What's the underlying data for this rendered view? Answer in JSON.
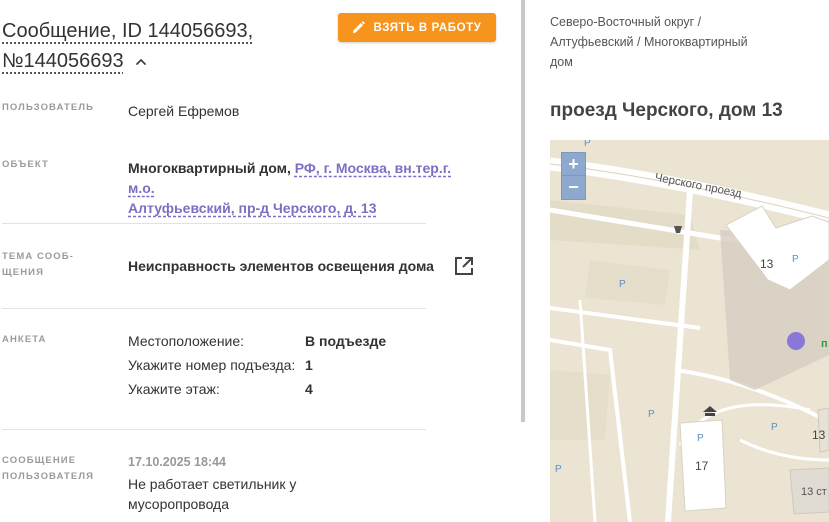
{
  "header": {
    "title_line1": "Сообщение, ID 144056693,",
    "title_line2": "№144056693",
    "take_button": "ВЗЯТЬ В РАБОТУ"
  },
  "user": {
    "label": "ПОЛЬЗОВАТЕЛЬ",
    "value": "Сергей Ефремов"
  },
  "object": {
    "label": "ОБЪЕКТ",
    "type": "Многоквартирный дом,",
    "address_line1": "РФ, г. Москва, вн.тер.г. м.о.",
    "address_line2": "Алтуфьевский, пр-д Черского, д. 13"
  },
  "topic": {
    "label_line1": "ТЕМА СООБ-",
    "label_line2": "ЩЕНИЯ",
    "value": "Неисправность элементов освещения дома"
  },
  "survey": {
    "label": "АНКЕТА",
    "rows": [
      {
        "key": "Местоположение:",
        "value": "В подъезде"
      },
      {
        "key": "Укажите номер подъезда:",
        "value": "1"
      },
      {
        "key": "Укажите этаж:",
        "value": "4"
      }
    ]
  },
  "user_message": {
    "label_line1": "СООБЩЕНИЕ",
    "label_line2": "ПОЛЬЗОВАТЕЛЯ",
    "date": "17.10.2025 18:44",
    "text": "Не работает светильник у мусоропровода"
  },
  "location": {
    "breadcrumb_line1": "Северо-Восточный округ /",
    "breadcrumb_line2": "Алтуфьевский / Многоквартирный",
    "breadcrumb_line3": "дом",
    "address": "проезд Черского, дом 13"
  },
  "map": {
    "street_label": "Черского проезд",
    "zoom_in": "+",
    "zoom_out": "−",
    "building_13": "13",
    "building_17": "17",
    "building_13_right": "13",
    "building_13_corner": "13 ст",
    "parking": "P",
    "green_label": "п"
  },
  "colors": {
    "accent": "#f7941d",
    "link": "#7b6fc4",
    "marker": "#8a78d8",
    "zoom": "#8fa8cd"
  }
}
